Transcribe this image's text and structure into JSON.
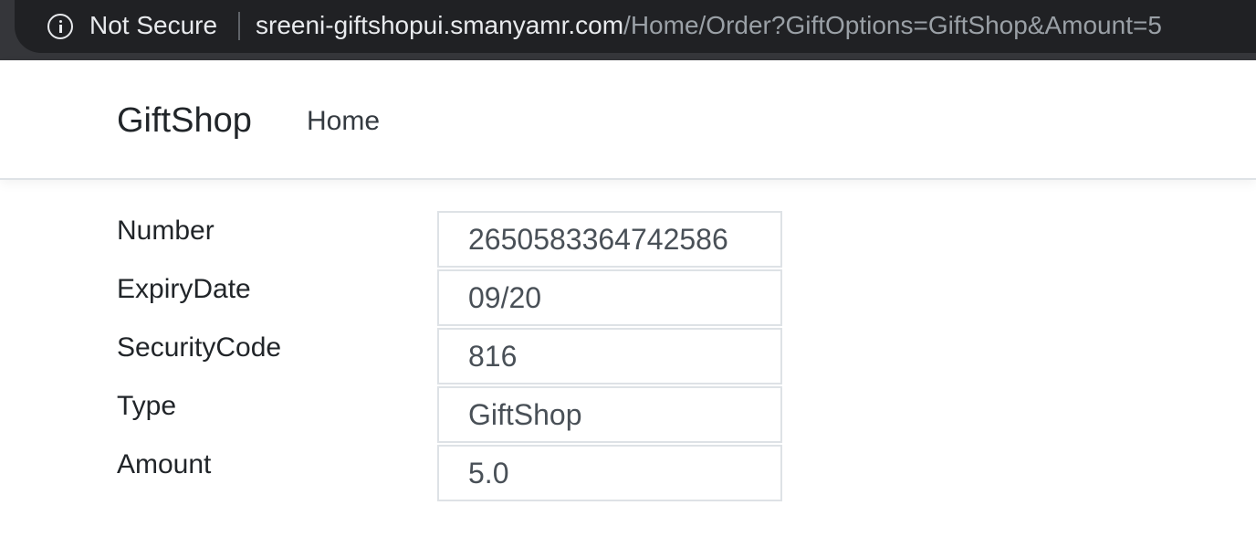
{
  "browser": {
    "security_label": "Not Secure",
    "url_host": "sreeni-giftshopui.smanyamr.com",
    "url_path": "/Home/Order?GiftOptions=GiftShop&Amount=5"
  },
  "navbar": {
    "brand": "GiftShop",
    "links": [
      "Home"
    ]
  },
  "order": {
    "fields": [
      {
        "label": "Number",
        "value": "2650583364742586"
      },
      {
        "label": "ExpiryDate",
        "value": "09/20"
      },
      {
        "label": "SecurityCode",
        "value": "816"
      },
      {
        "label": "Type",
        "value": "GiftShop"
      },
      {
        "label": "Amount",
        "value": "5.0"
      }
    ]
  }
}
